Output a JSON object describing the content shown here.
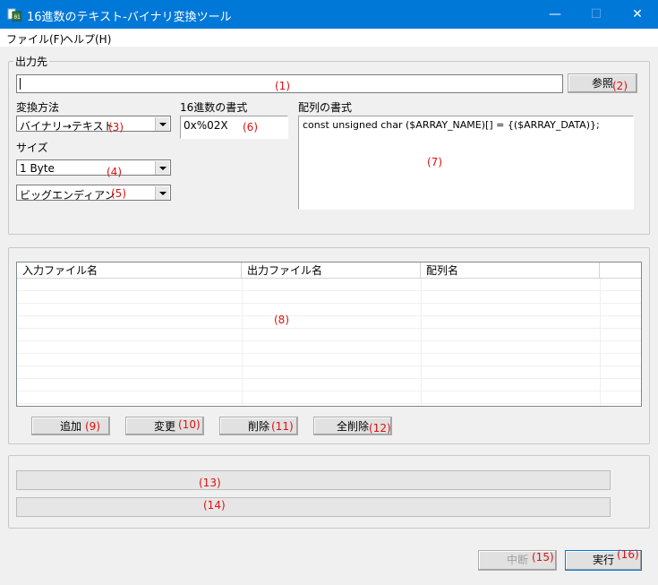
{
  "window": {
    "title": "16進数のテキスト-バイナリ変換ツール",
    "minimize_glyph": "—",
    "maximize_glyph": "☐",
    "close_glyph": "✕"
  },
  "menu": {
    "file": "ファイル(F)",
    "help": "ヘルプ(H)"
  },
  "output_group": {
    "label": "出力先",
    "path_value": "",
    "browse_label": "参照",
    "conversion_label": "変換方法",
    "conversion_value": "バイナリ→テキスト",
    "size_label": "サイズ",
    "size_value": "1 Byte",
    "endian_value": "ビッグエンディアン",
    "hex_format_label": "16進数の書式",
    "hex_format_value": "0x%02X",
    "array_format_label": "配列の書式",
    "array_format_value": "const unsigned char ($ARRAY_NAME)[] = {($ARRAY_DATA)};"
  },
  "file_list": {
    "columns": [
      "入力ファイル名",
      "出力ファイル名",
      "配列名",
      ""
    ],
    "rows": []
  },
  "list_buttons": {
    "add": "追加",
    "edit": "変更",
    "delete": "削除",
    "delete_all": "全削除"
  },
  "bottom_buttons": {
    "abort": "中断",
    "run": "実行"
  },
  "markers": {
    "m1": "(1)",
    "m2": "(2)",
    "m3": "(3)",
    "m4": "(4)",
    "m5": "(5)",
    "m6": "(6)",
    "m7": "(7)",
    "m8": "(8)",
    "m9": "(9)",
    "m10": "(10)",
    "m11": "(11)",
    "m12": "(12)",
    "m13": "(13)",
    "m14": "(14)",
    "m15": "(15)",
    "m16": "(16)"
  },
  "colors": {
    "titlebar": "#0078d7",
    "marker": "#e01010"
  }
}
